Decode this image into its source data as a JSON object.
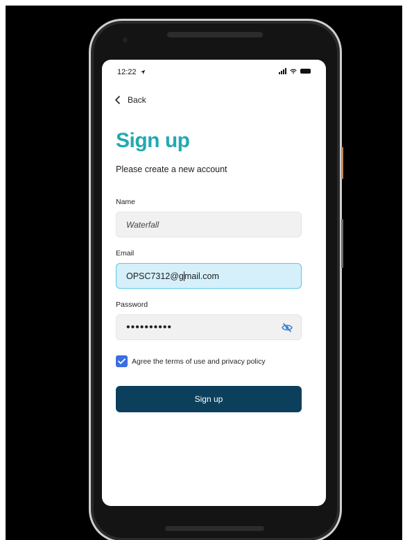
{
  "status_bar": {
    "time": "12:22"
  },
  "nav": {
    "back_label": "Back"
  },
  "header": {
    "title": "Sign up",
    "subtitle": "Please create a new account"
  },
  "form": {
    "name": {
      "label": "Name",
      "value": "Waterfall"
    },
    "email": {
      "label": "Email",
      "value_before_caret": "OPSC7312@g",
      "value_after_caret": "mail.com"
    },
    "password": {
      "label": "Password",
      "masked_value": "••••••••••"
    },
    "terms": {
      "label": "Agree the terms of use and privacy policy",
      "checked": true
    },
    "submit_label": "Sign up"
  },
  "colors": {
    "title": "#22a9b0",
    "button": "#0c3f5c",
    "checkbox": "#3b6fe0",
    "email_focus_bg": "#d5f0fa",
    "eye_icon": "#3d7fd6"
  },
  "icons": [
    "back-chevron-icon",
    "location-arrow-icon",
    "signal-icon",
    "wifi-icon",
    "battery-icon",
    "eye-slash-icon",
    "checkmark-icon"
  ]
}
